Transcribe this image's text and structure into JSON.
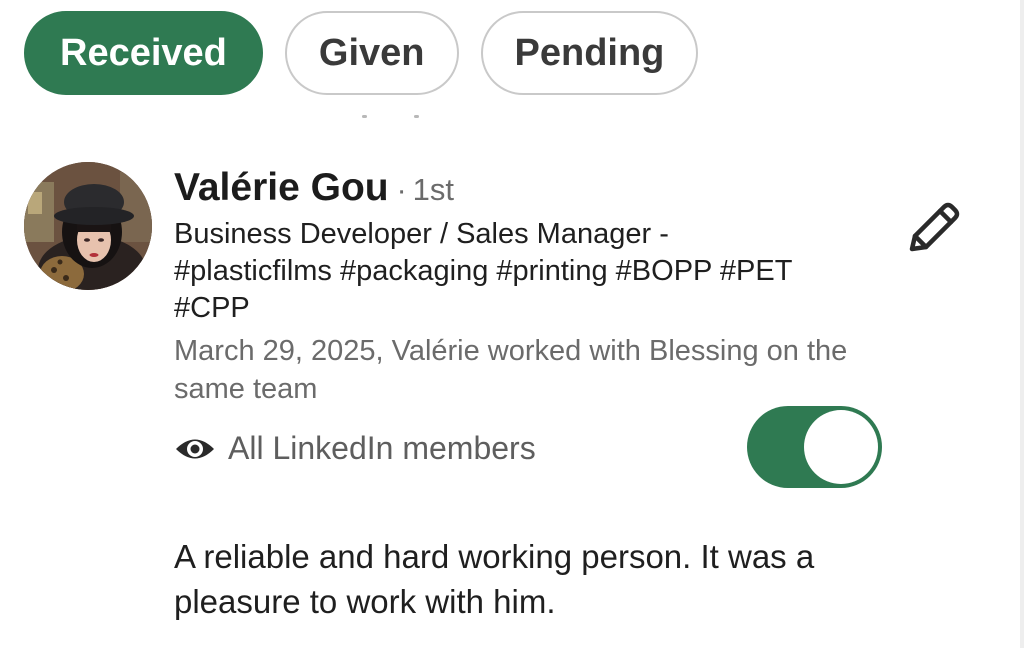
{
  "tabs": [
    {
      "label": "Received",
      "active": true
    },
    {
      "label": "Given",
      "active": false
    },
    {
      "label": "Pending",
      "active": false
    }
  ],
  "recommendation": {
    "name": "Valérie Gou",
    "separator": "·",
    "degree": "1st",
    "headline": "Business Developer / Sales Manager - #plasticfilms #packaging #printing #BOPP #PET #CPP",
    "relation": "March 29, 2025, Valérie worked with Blessing on the same team",
    "visibility_label": "All LinkedIn members",
    "visibility_enabled": true,
    "text": "A reliable and hard working person. It was a pleasure to work with him."
  },
  "icons": {
    "edit": "pencil-icon",
    "visibility": "eye-icon"
  },
  "colors": {
    "accent": "#2f7a52",
    "text_primary": "#1f1f1f",
    "text_secondary": "#6b6b6b",
    "tab_border": "#c9c9c9"
  }
}
